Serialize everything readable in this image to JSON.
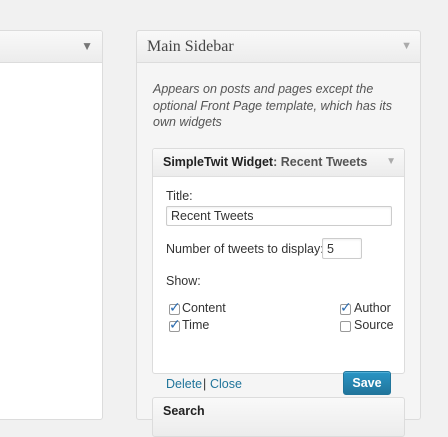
{
  "left_panel": {
    "toggle_icon": "triangle-down-icon"
  },
  "sidebar": {
    "title": "Main Sidebar",
    "toggle_icon": "triangle-down-icon",
    "description": "Appears on posts and pages except the optional Front Page template, which has its own widgets"
  },
  "widget": {
    "name": "SimpleTwit Widget",
    "title_suffix": ": Recent Tweets",
    "toggle_icon": "triangle-down-icon",
    "title_label": "Title:",
    "title_value": "Recent Tweets",
    "count_label": "Number of tweets to display:",
    "count_value": "5",
    "show_label": "Show:",
    "options": {
      "content": {
        "label": "Content",
        "checked": true
      },
      "author": {
        "label": "Author",
        "checked": true
      },
      "time": {
        "label": "Time",
        "checked": true
      },
      "source": {
        "label": "Source",
        "checked": false
      }
    },
    "delete_label": "Delete",
    "separator": "|",
    "close_label": "Close",
    "save_label": "Save"
  },
  "next_widget": {
    "title": "Search"
  },
  "colors": {
    "accent": "#21759b",
    "link": "#21759b",
    "background": "#f1f1f1"
  }
}
